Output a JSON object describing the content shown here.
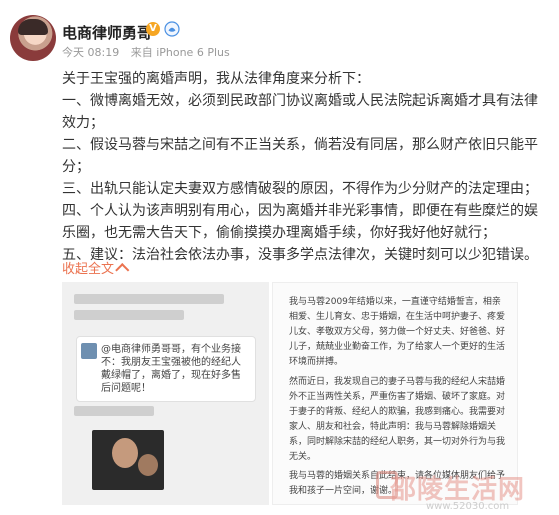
{
  "user": {
    "name": "电商律师勇哥",
    "badge": "V",
    "timestamp": "今天 08:19",
    "source": "来自 iPhone 6 Plus"
  },
  "post": {
    "lines": [
      "关于王宝强的离婚声明，我从法律角度来分析下：",
      "一、微博离婚无效，必须到民政部门协议离婚或人民法院起诉离婚才具有法律效力；",
      "二、假设马蓉与宋喆之间有不正当关系，倘若没有同居，那么财产依旧只能平分；",
      "三、出轨只能认定夫妻双方感情破裂的原因，不得作为少分财产的法定理由；",
      "四、个人认为该声明别有用心，因为离婚并非光彩事情，即便在有些糜烂的娱乐圈，也无需大告天下，偷偷摸摸办理离婚手续，你好我好他好就行；",
      "五、建议：法治社会依法办事，没事多学点法律次，关键时刻可以少犯错误。"
    ],
    "collapse_label": "收起全文"
  },
  "images": {
    "chat_bubble": "@电商律师勇哥哥，有个业务接不：我朋友王宝强被他的经纪人戴绿帽了，离婚了，现在好多售后问题呢！",
    "statement_paras": [
      "我与马蓉2009年结婚以来，一直谨守结婚誓言，相亲相爱、生儿育女、忠于婚姻，在生活中呵护妻子、疼爱儿女、孝敬双方父母，努力做一个好丈夫、好爸爸、好儿子，兢兢业业勤奋工作，为了给家人一个更好的生活环境而拼搏。",
      "然而近日，我发现自己的妻子马蓉与我的经纪人宋喆婚外不正当两性关系，严重伤害了婚姻、破坏了家庭。对于妻子的背叛、经纪人的欺骗，我感到痛心。我需要对家人、朋友和社会，特此声明：我与马蓉解除婚姻关系，同时解除宋喆的经纪人职务，其一切对外行为与我无关。",
      "我与马蓉的婚姻关系自此结束，请各位媒体朋友们给予我和孩子一片空间，谢谢。"
    ]
  },
  "watermark": {
    "text": "邵陵生活网",
    "url": "www.52030.com"
  },
  "colors": {
    "link": "#eb7350",
    "badge": "#f6a623",
    "text": "#333333",
    "muted": "#999999"
  }
}
